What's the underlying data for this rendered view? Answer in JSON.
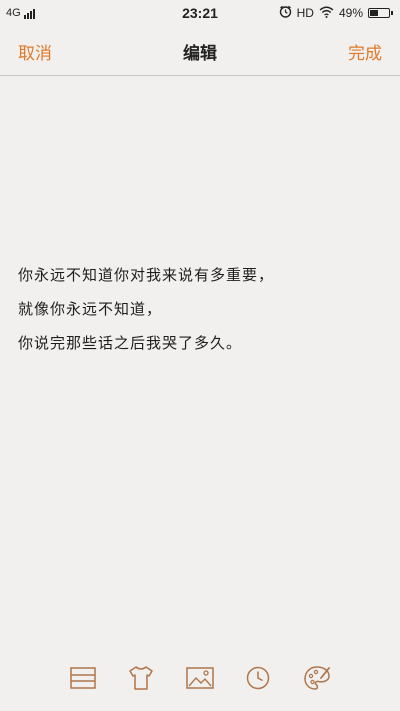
{
  "status_bar": {
    "network": "4G",
    "time": "23:21",
    "hd": "HD",
    "battery_percent": "49%",
    "battery_level": 0.49,
    "icons": [
      "signal-icon",
      "alarm-icon",
      "wifi-icon",
      "battery-icon"
    ]
  },
  "nav": {
    "cancel": "取消",
    "title": "编辑",
    "done": "完成"
  },
  "note": {
    "lines": [
      "你永远不知道你对我来说有多重要，",
      "就像你永远不知道，",
      "你说完那些话之后我哭了多久。"
    ]
  },
  "toolbar": {
    "icons": [
      "list-format-icon",
      "tshirt-icon",
      "image-icon",
      "clock-icon",
      "palette-icon"
    ]
  },
  "colors": {
    "accent": "#e07a2a",
    "background": "#f1f0ee",
    "text": "#1e1e1e"
  }
}
